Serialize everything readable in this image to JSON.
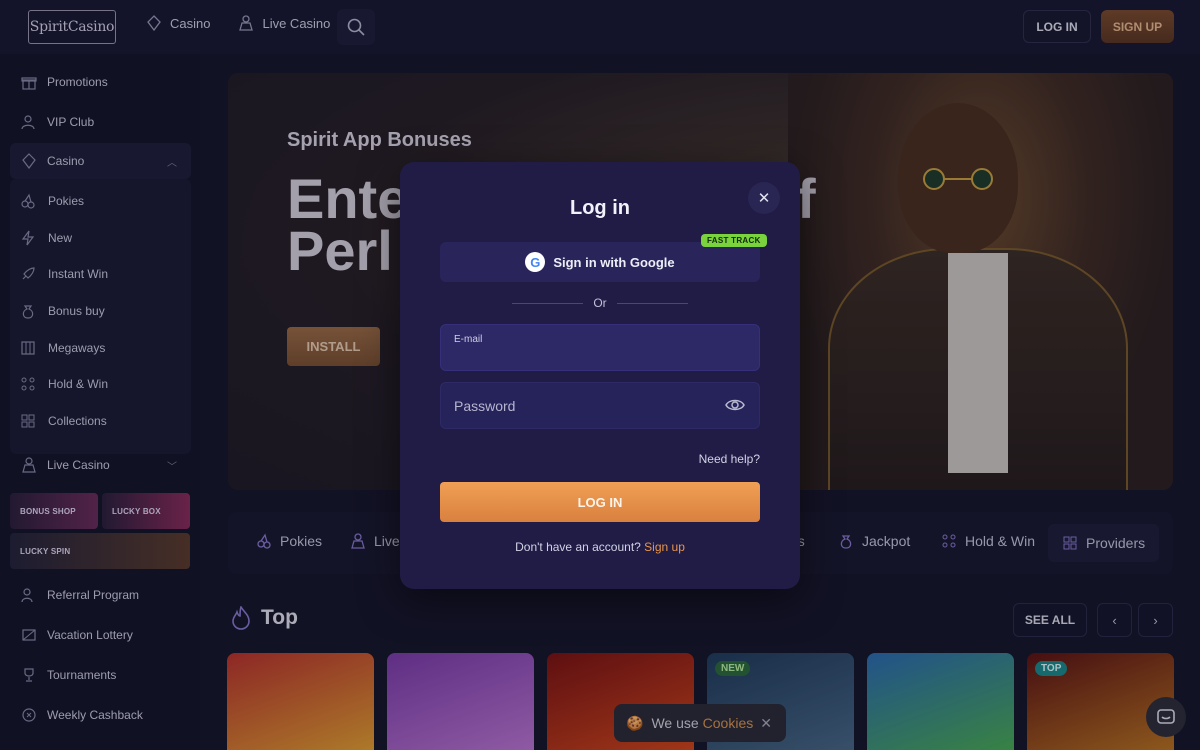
{
  "header": {
    "logo_text": "SpiritCasino",
    "nav": [
      {
        "label": "Casino",
        "icon": "casino-icon"
      },
      {
        "label": "Live Casino",
        "icon": "dealer-icon"
      }
    ],
    "login_label": "LOG IN",
    "signup_label": "SIGN UP"
  },
  "sidebar": {
    "items": [
      {
        "label": "Promotions",
        "icon": "gift-icon"
      },
      {
        "label": "VIP Club",
        "icon": "user-star-icon"
      },
      {
        "label": "Casino",
        "icon": "casino-icon"
      }
    ],
    "casino_sub": [
      {
        "label": "Pokies",
        "icon": "cherries-icon"
      },
      {
        "label": "New",
        "icon": "lightning-icon"
      },
      {
        "label": "Instant Win",
        "icon": "rocket-icon"
      },
      {
        "label": "Bonus buy",
        "icon": "money-bag-icon"
      },
      {
        "label": "Megaways",
        "icon": "grid-icon"
      },
      {
        "label": "Hold & Win",
        "icon": "dots-icon"
      },
      {
        "label": "Collections",
        "icon": "collections-icon"
      }
    ],
    "live_casino_label": "Live Casino",
    "promo_tiles": {
      "bonus_shop": "BONUS SHOP",
      "lucky_box": "LUCKY BOX",
      "lucky_spin": "LUCKY SPIN"
    },
    "bottom_items": [
      {
        "label": "Referral Program",
        "icon": "referral-icon"
      },
      {
        "label": "Vacation Lottery",
        "icon": "ticket-icon"
      },
      {
        "label": "Tournaments",
        "icon": "trophy-icon"
      },
      {
        "label": "Weekly Cashback",
        "icon": "cashback-icon"
      }
    ]
  },
  "banner": {
    "subtitle": "Spirit App Bonuses",
    "title_line1": "Ente",
    "title_line2": "Perl",
    "title_right": "f",
    "install_label": "INSTALL"
  },
  "categories": [
    {
      "label": "Pokies",
      "icon": "cherries-icon"
    },
    {
      "label": "Live",
      "icon": "dealer-icon"
    },
    {
      "label": "es",
      "icon": ""
    },
    {
      "label": "Jackpot",
      "icon": "money-bag-icon"
    },
    {
      "label": "Hold & Win",
      "icon": "dots-icon"
    },
    {
      "label": "Providers",
      "icon": "grid-icon"
    }
  ],
  "top_section": {
    "title": "Top",
    "see_all": "SEE ALL",
    "games": [
      {
        "badge": "",
        "color_a": "#b8302a",
        "color_b": "#e6a830"
      },
      {
        "badge": "",
        "color_a": "#7a3aa8",
        "color_b": "#c07ad6"
      },
      {
        "badge": "",
        "color_a": "#7a1010",
        "color_b": "#d84a1a"
      },
      {
        "badge": "NEW",
        "color_a": "#1e3a5a",
        "color_b": "#4a6a88"
      },
      {
        "badge": "",
        "color_a": "#2a6ab0",
        "color_b": "#4ab04a"
      },
      {
        "badge": "TOP",
        "color_a": "#5a1010",
        "color_b": "#c07a20"
      }
    ]
  },
  "cookie": {
    "text": "We use",
    "link": "Cookies"
  },
  "modal": {
    "title": "Log in",
    "google_label": "Sign in with Google",
    "fast_track": "FAST TRACK",
    "or_label": "Or",
    "email_label": "E-mail",
    "email_value": "",
    "password_placeholder": "Password",
    "need_help": "Need help?",
    "login_label": "LOG IN",
    "no_account_text": "Don't have an account?",
    "signup_link": "Sign up"
  }
}
